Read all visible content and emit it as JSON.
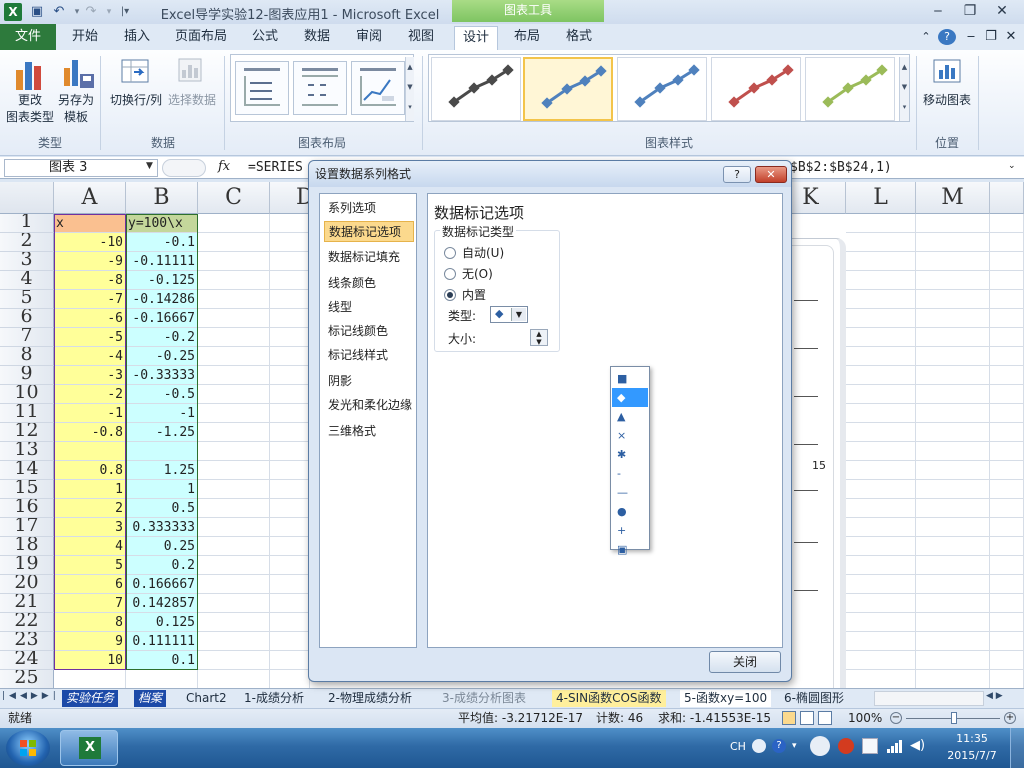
{
  "window": {
    "title": "Excel导学实验12-图表应用1 - Microsoft Excel",
    "context_tools": "图表工具"
  },
  "ribbon_tabs": [
    "文件",
    "开始",
    "插入",
    "页面布局",
    "公式",
    "数据",
    "审阅",
    "视图",
    "设计",
    "布局",
    "格式"
  ],
  "ribbon": {
    "change_type": [
      "更改",
      "图表类型"
    ],
    "save_template": [
      "另存为",
      "模板"
    ],
    "group_type": "类型",
    "switch_rowcol": "切换行/列",
    "select_data": "选择数据",
    "group_data": "数据",
    "group_layout": "图表布局",
    "group_styles": "图表样式",
    "move_chart": "移动图表",
    "group_location": "位置"
  },
  "style_colors": [
    "#4a4a4a",
    "#4f81bd",
    "#4f81bd",
    "#c0504d",
    "#9bbb59"
  ],
  "formula_bar": {
    "name_box": "图表 3",
    "fx": "fx",
    "formula_left": "=SERIES",
    "formula_right": "$B$2:$B$24,1)"
  },
  "columns": [
    "A",
    "B",
    "C",
    "D",
    "K",
    "L",
    "M"
  ],
  "rows": [
    "1",
    "2",
    "3",
    "4",
    "5",
    "6",
    "7",
    "8",
    "9",
    "10",
    "11",
    "12",
    "13",
    "14",
    "15",
    "16",
    "17",
    "18",
    "19",
    "20",
    "21",
    "22",
    "23",
    "24",
    "25"
  ],
  "table": {
    "header_a": "x",
    "header_b": "y=100\\x",
    "col_a": [
      "-10",
      "-9",
      "-8",
      "-7",
      "-6",
      "-5",
      "-4",
      "-3",
      "-2",
      "-1",
      "-0.8",
      "",
      "0.8",
      "1",
      "2",
      "3",
      "4",
      "5",
      "6",
      "7",
      "8",
      "9",
      "10"
    ],
    "col_b": [
      "-0.1",
      "-0.11111",
      "-0.125",
      "-0.14286",
      "-0.16667",
      "-0.2",
      "-0.25",
      "-0.33333",
      "-0.5",
      "-1",
      "-1.25",
      "",
      "1.25",
      "1",
      "0.5",
      "0.333333",
      "0.25",
      "0.2",
      "0.166667",
      "0.142857",
      "0.125",
      "0.111111",
      "0.1"
    ]
  },
  "chart_axis_label": "15",
  "sheet_tabs": [
    "实验任务",
    "档案",
    "Chart2",
    "1-成绩分析",
    "2-物理成绩分析",
    "3-成绩分析图表",
    "4-SIN函数COS函数",
    "5-函数xy=100",
    "6-椭圆图形"
  ],
  "status": {
    "ready": "就绪",
    "average": "平均值: -3.21712E-17",
    "count": "计数: 46",
    "sum": "求和: -1.41553E-15",
    "zoom": "100%"
  },
  "taskbar": {
    "lang": "CH",
    "time": "11:35",
    "date": "2015/7/7"
  },
  "dialog": {
    "title": "设置数据系列格式",
    "help": "?",
    "nav": [
      "系列选项",
      "数据标记选项",
      "数据标记填充",
      "线条颜色",
      "线型",
      "标记线颜色",
      "标记线样式",
      "阴影",
      "发光和柔化边缘",
      "三维格式"
    ],
    "heading": "数据标记选项",
    "group_label": "数据标记类型",
    "option_auto": "自动(U)",
    "option_none": "无(O)",
    "option_builtin": "内置",
    "type_label": "类型:",
    "size_label": "大小:",
    "close": "关闭",
    "marker_types": [
      "■",
      "◆",
      "▲",
      "×",
      "✱",
      "-",
      "—",
      "●",
      "+",
      "▣"
    ]
  }
}
